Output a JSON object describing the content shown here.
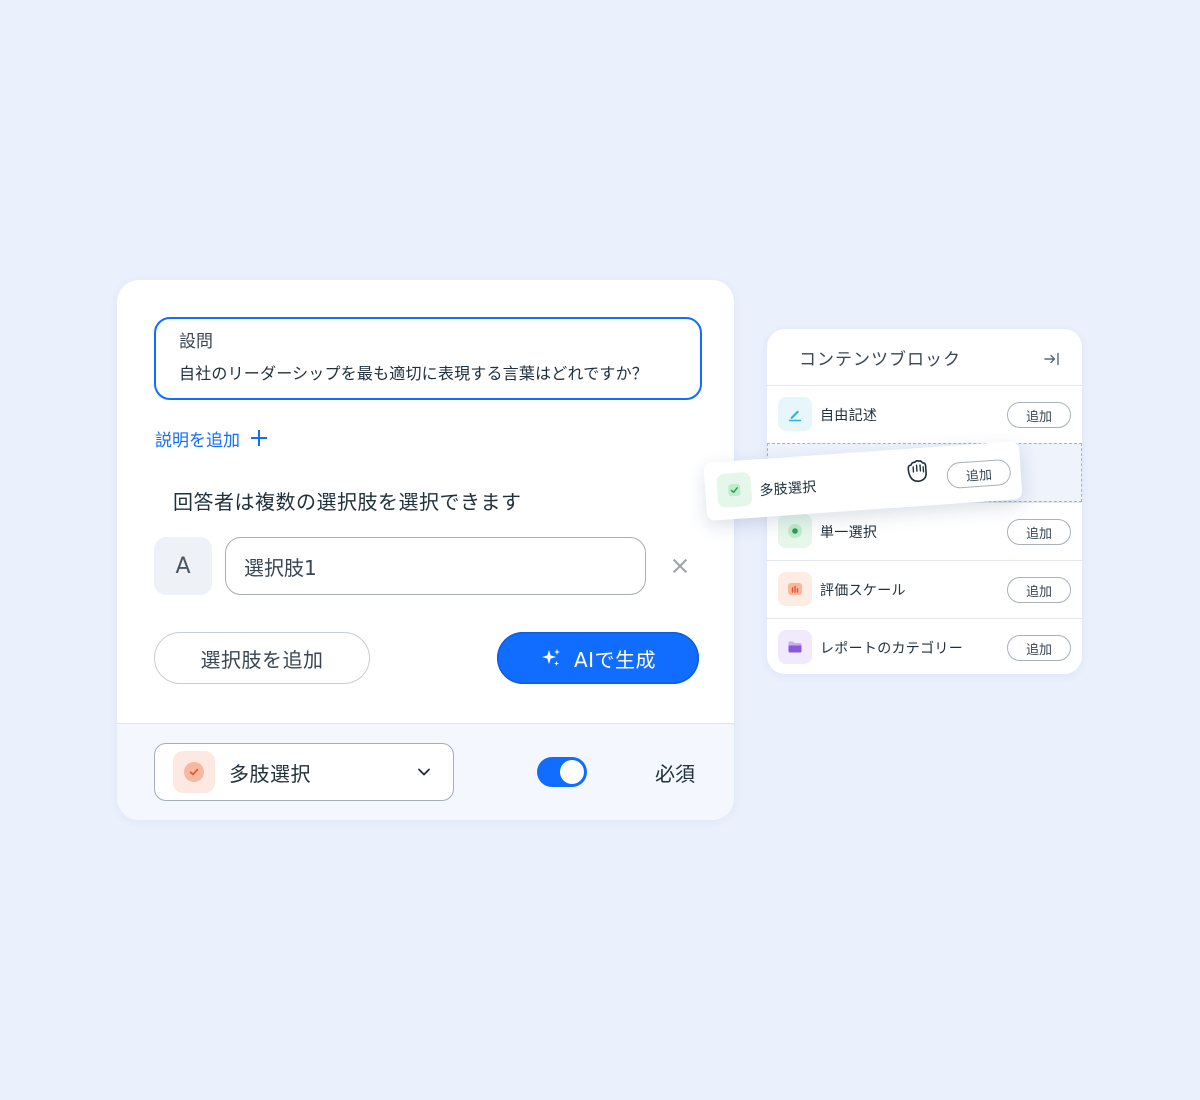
{
  "editor": {
    "question": {
      "label": "設問",
      "text": "自社のリーダーシップを最も適切に表現する言葉はどれですか？"
    },
    "add_description": "説明を追加",
    "multi_select_note": "回答者は複数の選択肢を選択できます",
    "choices": [
      {
        "letter": "A",
        "value": "選択肢1"
      }
    ],
    "add_choice_button": "選択肢を追加",
    "ai_generate_button": "AIで生成",
    "footer": {
      "question_type": "多肢選択",
      "required_toggle_on": true,
      "required_label": "必須"
    }
  },
  "content_blocks": {
    "title": "コンテンツブロック",
    "add_label": "追加",
    "items": [
      {
        "label": "自由記述",
        "icon": "edit-icon",
        "color": "#2bb3e0"
      },
      {
        "label": "多肢選択",
        "icon": "checkbox-icon",
        "color": "#3fc86b",
        "dragging": true
      },
      {
        "label": "単一選択",
        "icon": "radio-icon",
        "color": "#3fc86b"
      },
      {
        "label": "評価スケール",
        "icon": "scale-icon",
        "color": "#f07a4a"
      },
      {
        "label": "レポートのカテゴリー",
        "icon": "folder-icon",
        "color": "#8a5ad6"
      }
    ]
  },
  "colors": {
    "accent": "#116dff",
    "background": "#eaf0fc"
  }
}
